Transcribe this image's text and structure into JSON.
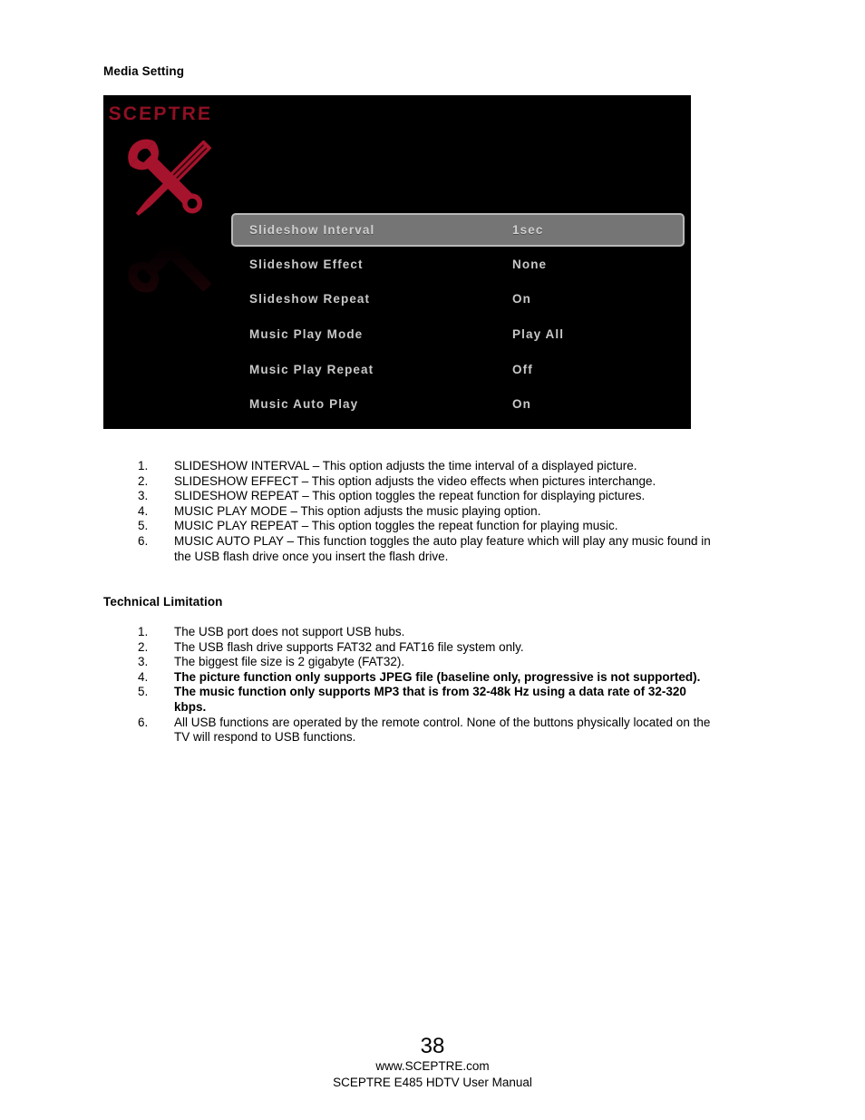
{
  "document": {
    "media_setting_heading": "Media Setting",
    "technical_limitation_heading": "Technical Limitation"
  },
  "osd": {
    "brand_logo": "SCEPTRE",
    "icon": "wrench-screwdriver-tools-icon",
    "accent_color": "#a6132c",
    "background_color": "#000000",
    "highlight_color": "#757575",
    "highlight_border_color": "#b9b9b9",
    "text_color": "#c9c9c9",
    "rows": [
      {
        "label": "Slideshow Interval",
        "value": "1sec",
        "selected": true
      },
      {
        "label": "Slideshow Effect",
        "value": "None",
        "selected": false
      },
      {
        "label": "Slideshow Repeat",
        "value": "On",
        "selected": false
      },
      {
        "label": "Music Play Mode",
        "value": "Play All",
        "selected": false
      },
      {
        "label": "Music Play Repeat",
        "value": "Off",
        "selected": false
      },
      {
        "label": "Music Auto Play",
        "value": "On",
        "selected": false
      }
    ]
  },
  "media_list": [
    {
      "num": "1.",
      "text": "SLIDESHOW INTERVAL – This option adjusts the time interval of a displayed picture.",
      "bold": false
    },
    {
      "num": "2.",
      "text": "SLIDESHOW EFFECT – This option adjusts the video effects when pictures interchange.",
      "bold": false
    },
    {
      "num": "3.",
      "text": "SLIDESHOW REPEAT – This option toggles the repeat function for displaying pictures.",
      "bold": false
    },
    {
      "num": "4.",
      "text": "MUSIC PLAY MODE – This option adjusts the music playing option.",
      "bold": false
    },
    {
      "num": "5.",
      "text": "MUSIC PLAY REPEAT – This option toggles the repeat function for playing music.",
      "bold": false
    },
    {
      "num": "6.",
      "text": "MUSIC AUTO PLAY – This function toggles the auto play feature which will play any music found in the USB flash drive once you insert the flash drive.",
      "bold": false
    }
  ],
  "tech_list": [
    {
      "num": "1.",
      "text": "The USB port does not support USB hubs.",
      "bold": false
    },
    {
      "num": "2.",
      "text": "The USB flash drive supports FAT32 and FAT16 file system only.",
      "bold": false
    },
    {
      "num": "3.",
      "text": "The biggest file size is 2 gigabyte (FAT32).",
      "bold": false
    },
    {
      "num": "4.",
      "text": "The picture function only supports JPEG file (baseline only, progressive is not supported).",
      "bold": true
    },
    {
      "num": "5.",
      "text": "The music function only supports MP3 that is from 32-48k Hz using a data rate of 32-320 kbps.",
      "bold": true
    },
    {
      "num": "6.",
      "text": "All USB functions are operated by the remote control.  None of the buttons physically located on the TV will respond to USB functions.",
      "bold": false
    }
  ],
  "footer": {
    "page_number": "38",
    "website": "www.SCEPTRE.com",
    "manual": "SCEPTRE E485 HDTV User Manual"
  }
}
